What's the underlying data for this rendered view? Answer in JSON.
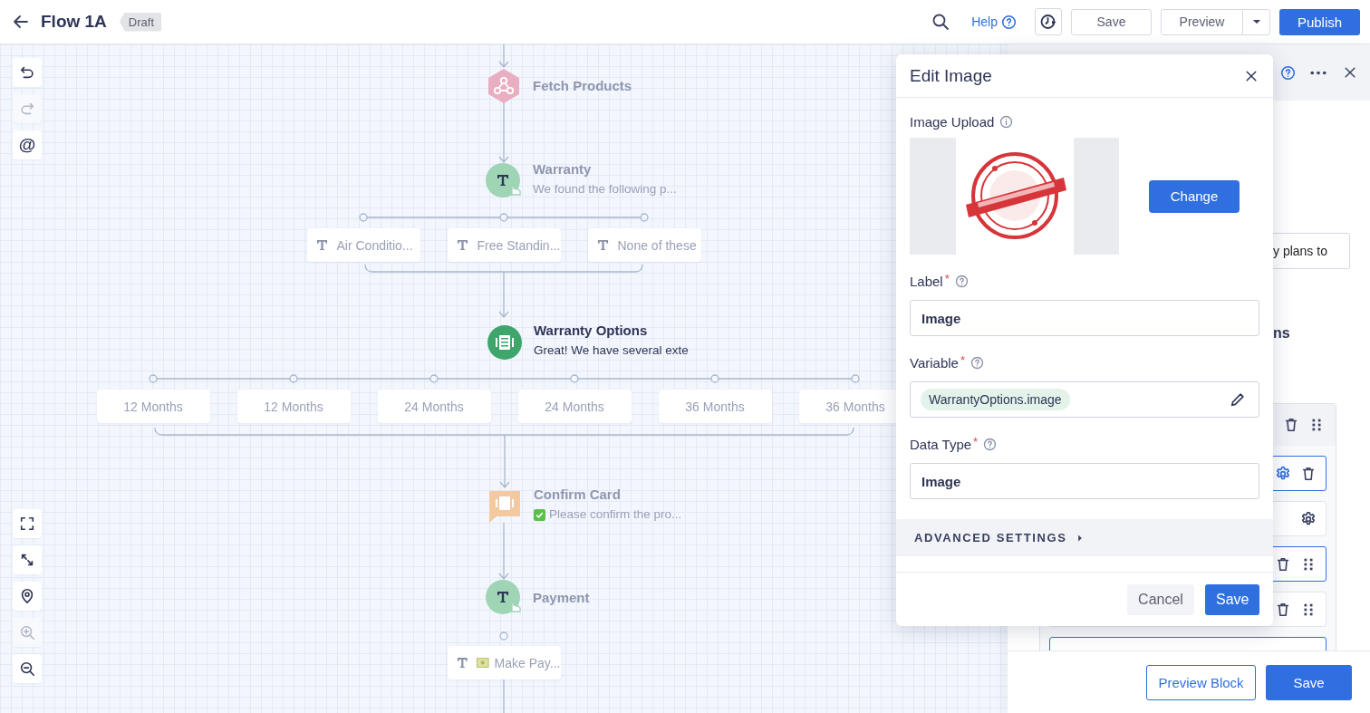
{
  "header": {
    "title": "Flow 1A",
    "badge": "Draft",
    "help": "Help",
    "buttons": [
      {
        "label": "Save",
        "kind": "outline"
      },
      {
        "label": "Preview",
        "kind": "split"
      },
      {
        "label": "Publish",
        "kind": "primary"
      }
    ]
  },
  "canvas_tools": {
    "top": [
      {
        "kind": "undo",
        "disabled": false
      },
      {
        "kind": "redo",
        "disabled": true
      },
      {
        "kind": "mention",
        "glyph": "@",
        "disabled": false
      }
    ],
    "bottom": [
      {
        "kind": "fit",
        "disabled": false
      },
      {
        "kind": "expand",
        "disabled": false
      },
      {
        "kind": "locate",
        "disabled": false
      },
      {
        "kind": "zoom_in",
        "disabled": true
      },
      {
        "kind": "zoom_out",
        "disabled": false
      }
    ]
  },
  "flow": [
    {
      "kind": "webhook",
      "title": "Fetch Products",
      "dimmed": true
    },
    {
      "kind": "text",
      "title": "Warranty",
      "subtitle": "We found the following p...",
      "dimmed": true
    },
    {
      "kind": "choices",
      "dimmed": true,
      "items": [
        {
          "label": "Air Conditio...",
          "kind": "text"
        },
        {
          "label": "Free Standin...",
          "kind": "text"
        },
        {
          "label": "None of these",
          "kind": "text"
        }
      ]
    },
    {
      "kind": "carousel",
      "title": "Warranty Options",
      "subtitle": "Great! We have several exte",
      "dimmed": false
    },
    {
      "kind": "choices",
      "dimmed": true,
      "items": [
        {
          "label": "12 Months",
          "kind": "plain"
        },
        {
          "label": "12 Months",
          "kind": "plain"
        },
        {
          "label": "24 Months",
          "kind": "plain"
        },
        {
          "label": "24 Months",
          "kind": "plain"
        },
        {
          "label": "36 Months",
          "kind": "plain"
        },
        {
          "label": "36 Months",
          "kind": "plain"
        }
      ]
    },
    {
      "kind": "confirm",
      "title": "Confirm Card",
      "subtitle": "Please confirm the pro...",
      "subtitle_prefix": {
        "kind": "check"
      },
      "dimmed": true
    },
    {
      "kind": "text",
      "title": "Payment",
      "dimmed": true
    },
    {
      "kind": "choices",
      "dimmed": true,
      "items": [
        {
          "label": "Make Pay...",
          "kind": "text",
          "label_prefix": {
            "kind": "cash"
          }
        }
      ]
    }
  ],
  "side_panel": {
    "field_text": "y plans to",
    "heading_fragment": "ns",
    "rows": [
      {
        "kind": "header",
        "selected": false,
        "actions": [
          {
            "kind": "delete"
          },
          {
            "kind": "drag"
          }
        ]
      },
      {
        "kind": "item",
        "selected": true,
        "actions": [
          {
            "kind": "settings"
          },
          {
            "kind": "delete"
          }
        ]
      },
      {
        "kind": "item",
        "selected": false,
        "actions": [
          {
            "kind": "settings"
          }
        ]
      },
      {
        "kind": "item",
        "selected": true,
        "actions": [
          {
            "kind": "delete"
          },
          {
            "kind": "drag"
          }
        ]
      },
      {
        "kind": "item",
        "selected": false,
        "actions": [
          {
            "kind": "delete"
          },
          {
            "kind": "drag"
          }
        ]
      },
      {
        "kind": "item",
        "selected": true,
        "actions": []
      }
    ],
    "buttons": [
      {
        "label": "Preview Block",
        "kind": "outline"
      },
      {
        "label": "Save",
        "kind": "primary"
      }
    ]
  },
  "modal": {
    "title": "Edit Image",
    "upload": {
      "label": "Image Upload",
      "button": "Change"
    },
    "fields": [
      {
        "label": "Label",
        "required_mark": "*",
        "kind": "text",
        "value": "Image"
      },
      {
        "label": "Variable",
        "required_mark": "*",
        "kind": "variable",
        "value": "WarrantyOptions.image"
      },
      {
        "label": "Data Type",
        "required_mark": "*",
        "kind": "text",
        "value": "Image"
      }
    ],
    "advanced": {
      "label": "ADVANCED SETTINGS",
      "expanded": false
    },
    "buttons": [
      {
        "label": "Cancel",
        "kind": "secondary"
      },
      {
        "label": "Save",
        "kind": "primary"
      }
    ]
  }
}
